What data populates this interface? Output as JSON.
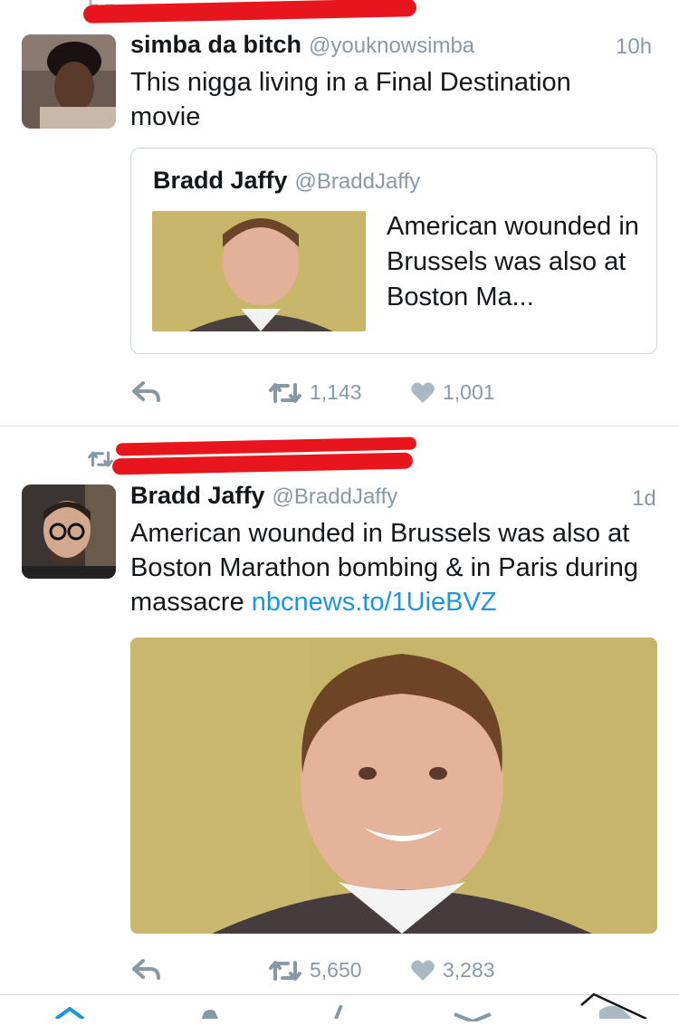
{
  "colors": {
    "accent": "#1b95e0",
    "muted": "#8899a6",
    "redaction": "#e8161c"
  },
  "tweet1": {
    "name": "simba da bitch",
    "handle": "@youknowsimba",
    "time": "10h",
    "text": "This nigga living in a Final Destination movie",
    "avatar_icon": "profile-photo",
    "quote": {
      "name": "Bradd Jaffy",
      "handle": "@BraddJaffy",
      "text": "American wounded in Brussels was also at Boston Ma..."
    },
    "actions": {
      "retweets": "1,143",
      "likes": "1,001"
    }
  },
  "tweet2": {
    "name": "Bradd Jaffy",
    "handle": "@BraddJaffy",
    "time": "1d",
    "text": "American wounded in Brussels was also at Boston Marathon bombing & in Paris during massacre ",
    "link": "nbcnews.to/1UieBVZ",
    "actions": {
      "retweets": "5,650",
      "likes": "3,283"
    }
  }
}
